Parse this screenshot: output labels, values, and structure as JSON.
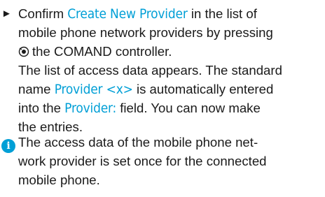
{
  "step": {
    "bullet": "►",
    "line1_pre": "Confirm ",
    "line1_hl": "Create New Provider",
    "line1_post": " in the list of",
    "line2": "mobile phone network providers by pressing",
    "line3_post": "the COMAND controller.",
    "line4": "The list of access data appears. The standard",
    "line5_pre": "name ",
    "line5_hl": "Provider <x>",
    "line5_post": " is automatically entered",
    "line6_pre": "into the ",
    "line6_hl": "Provider:",
    "line6_post": " field. You can now make",
    "line7": "the entries."
  },
  "note": {
    "icon": "info-icon",
    "line1": "The access data of the mobile phone net-",
    "line2": "work provider is set once for the connected",
    "line3": "mobile phone."
  },
  "colors": {
    "highlight": "#009fd6",
    "text": "#1a1a1a",
    "info_icon": "#009fd6"
  }
}
